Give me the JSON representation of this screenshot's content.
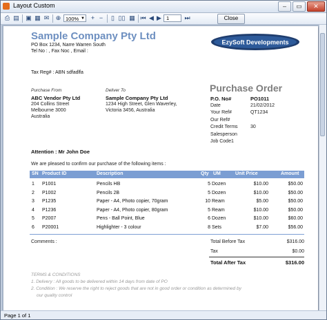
{
  "window": {
    "title": "Layout Custom",
    "min": "–",
    "max": "▭",
    "close": "✕"
  },
  "toolbar": {
    "zoom": "100%",
    "page_input": "1",
    "close_label": "Close"
  },
  "status": {
    "page_text": "Page 1 of 1"
  },
  "doc": {
    "company": "Sample Company Pty Ltd",
    "address1": "PO Box 1234, Narre Warren South",
    "address2": "Tel No : , Fax Noc , Email :",
    "tax": "Tax Reg# : ABN sdfadlfa",
    "logo_text": "EzySoft Developments",
    "po_title": "Purchase Order",
    "purchase_from_label": "Purchase From",
    "vendor_name": "ABC Vendor Pty Ltd",
    "vendor_addr1": "204 Collins Street",
    "vendor_addr2": "Melbourne 3000",
    "vendor_addr3": "Australia",
    "deliver_to_label": "Deliver To",
    "deliver_name": "Sample Company Pty Ltd",
    "deliver_addr1": "1234 High Street, Glen Waverley,",
    "deliver_addr2": "Victoria 3456, Australia",
    "meta": [
      {
        "label": "P.O. No#",
        "value": "PO1011",
        "bold": true
      },
      {
        "label": "Date",
        "value": "21/02/2012",
        "bold": false
      },
      {
        "label": "Your Ref#",
        "value": "QT1234",
        "bold": false
      },
      {
        "label": "Our Ref#",
        "value": "",
        "bold": false
      },
      {
        "label": "Credit Terms",
        "value": "30",
        "bold": false
      },
      {
        "label": "Salesperson",
        "value": "",
        "bold": false
      },
      {
        "label": "Job Code1",
        "value": "",
        "bold": false
      }
    ],
    "attention": "Attention : Mr John Doe",
    "intro": "We are pleased to confirm our purchase of the following items :",
    "columns": [
      "SN",
      "Product ID",
      "Description",
      "Qty",
      "UM",
      "Unit Price",
      "Amount"
    ],
    "items": [
      {
        "sn": "1",
        "id": "P1001",
        "desc": "Pencils HB",
        "qty": "5",
        "um": "Dozen",
        "price": "$10.00",
        "amount": "$50.00"
      },
      {
        "sn": "2",
        "id": "P1002",
        "desc": "Pencils 2B",
        "qty": "5",
        "um": "Dozen",
        "price": "$10.00",
        "amount": "$50.00"
      },
      {
        "sn": "3",
        "id": "P1235",
        "desc": "Paper - A4, Photo copier, 70gram",
        "qty": "10",
        "um": "Ream",
        "price": "$5.00",
        "amount": "$50.00"
      },
      {
        "sn": "4",
        "id": "P1236",
        "desc": "Paper - A4, Photo copier, 80gram",
        "qty": "5",
        "um": "Ream",
        "price": "$10.00",
        "amount": "$50.00"
      },
      {
        "sn": "5",
        "id": "P2007",
        "desc": "Pens - Ball Point, Blue",
        "qty": "6",
        "um": "Dozen",
        "price": "$10.00",
        "amount": "$60.00"
      },
      {
        "sn": "6",
        "id": "P20001",
        "desc": "Highlighter - 3 colour",
        "qty": "8",
        "um": "Sets",
        "price": "$7.00",
        "amount": "$56.00"
      }
    ],
    "comments_label": "Comments :",
    "total_before_tax_label": "Total Before Tax",
    "total_before_tax": "$316.00",
    "tax_label": "Tax",
    "tax_value": "$0.00",
    "total_after_tax_label": "Total After Tax",
    "total_after_tax": "$316.00",
    "terms_title": "TERMS & CONDITIONS",
    "terms1": "1. Delivery : All goods to be delivered within 14 days from date of PO",
    "terms2": "2. Condition : We reserve the right to reject goods that are not in good order or condition as determined by",
    "terms3": "our quality control"
  },
  "colors": {
    "accent": "#6d8fc0",
    "table_header": "#7b9ed3"
  }
}
